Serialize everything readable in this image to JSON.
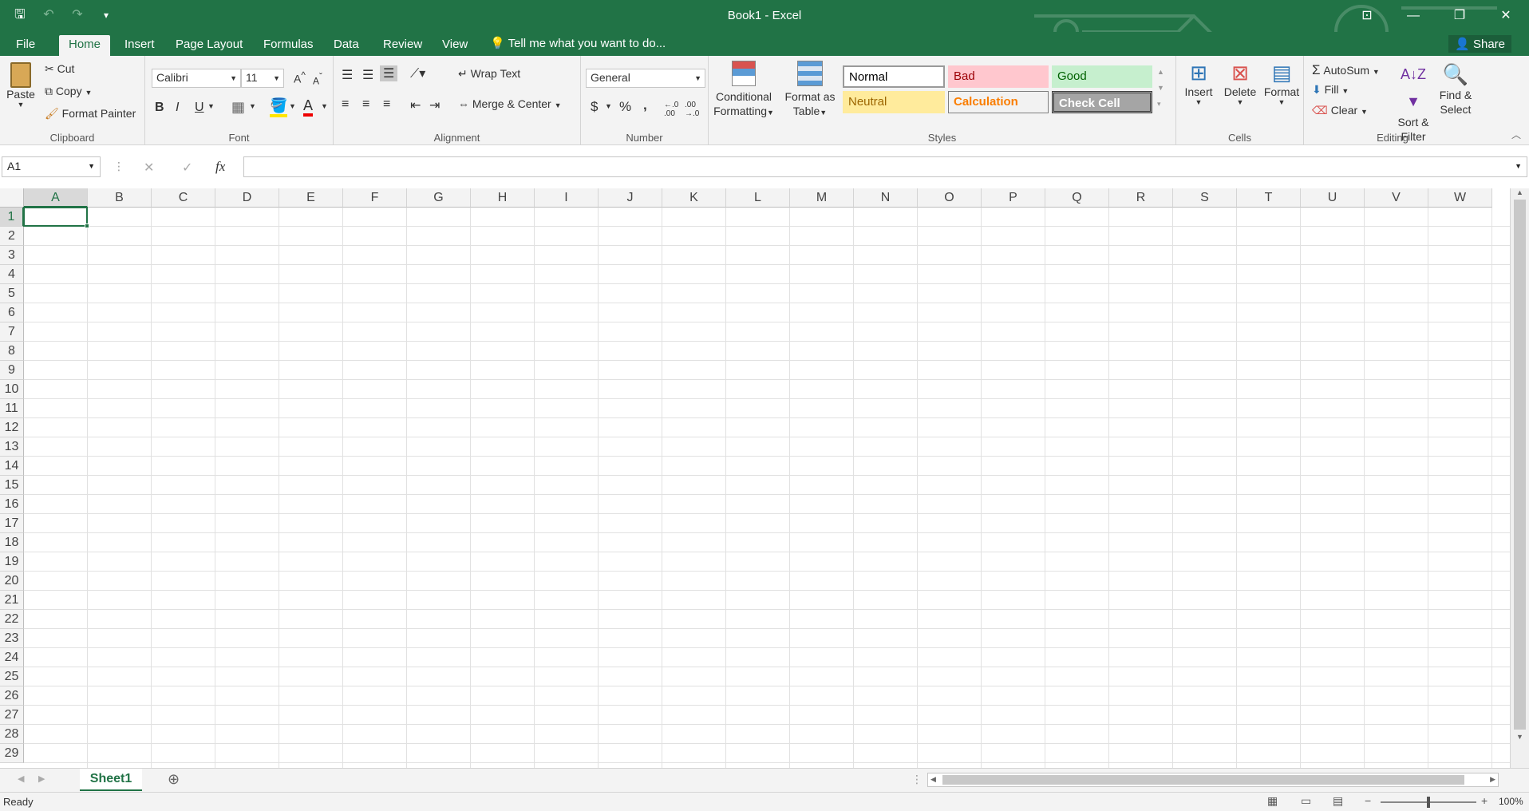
{
  "app": {
    "title": "Book1 - Excel"
  },
  "colors": {
    "brand": "#217346",
    "ribbon_bg": "#f3f3f3"
  },
  "window_controls": [
    "ribbon-display-icon",
    "minimize-icon",
    "maximize-icon",
    "close-icon"
  ],
  "ribbon_tabs": [
    "File",
    "Home",
    "Insert",
    "Page Layout",
    "Formulas",
    "Data",
    "Review",
    "View"
  ],
  "active_tab": "Home",
  "tell_me": "Tell me what you want to do...",
  "share": "Share",
  "clipboard": {
    "paste": "Paste",
    "cut": "Cut",
    "copy": "Copy",
    "format_painter": "Format Painter",
    "label": "Clipboard"
  },
  "font": {
    "name": "Calibri",
    "size": "11",
    "bold": "B",
    "italic": "I",
    "underline": "U",
    "label": "Font"
  },
  "alignment": {
    "wrap": "Wrap Text",
    "merge": "Merge & Center",
    "label": "Alignment"
  },
  "number": {
    "format": "General",
    "currency": "$",
    "percent": "%",
    "comma": ",",
    "label": "Number"
  },
  "styles": {
    "conditional": "Conditional Formatting",
    "format_table": "Format as Table",
    "items": [
      "Normal",
      "Bad",
      "Good",
      "Neutral",
      "Calculation",
      "Check Cell"
    ],
    "label": "Styles"
  },
  "cells": {
    "insert": "Insert",
    "delete": "Delete",
    "format": "Format",
    "label": "Cells"
  },
  "editing": {
    "autosum": "AutoSum",
    "fill": "Fill",
    "clear": "Clear",
    "sort": "Sort & Filter",
    "find": "Find & Select",
    "label": "Editing"
  },
  "formula_bar": {
    "name_box": "A1",
    "fx": "fx",
    "cancel": "✕",
    "enter": "✓",
    "value": ""
  },
  "columns": [
    "A",
    "B",
    "C",
    "D",
    "E",
    "F",
    "G",
    "H",
    "I",
    "J",
    "K",
    "L",
    "M",
    "N",
    "O",
    "P",
    "Q",
    "R",
    "S",
    "T",
    "U",
    "V",
    "W"
  ],
  "rows": [
    "1",
    "2",
    "3",
    "4",
    "5",
    "6",
    "7",
    "8",
    "9",
    "10",
    "11",
    "12",
    "13",
    "14",
    "15",
    "16",
    "17",
    "18",
    "19",
    "20",
    "21",
    "22",
    "23",
    "24",
    "25",
    "26",
    "27",
    "28",
    "29"
  ],
  "sheet_tab": "Sheet1",
  "status": {
    "ready": "Ready",
    "zoom": "100%"
  }
}
